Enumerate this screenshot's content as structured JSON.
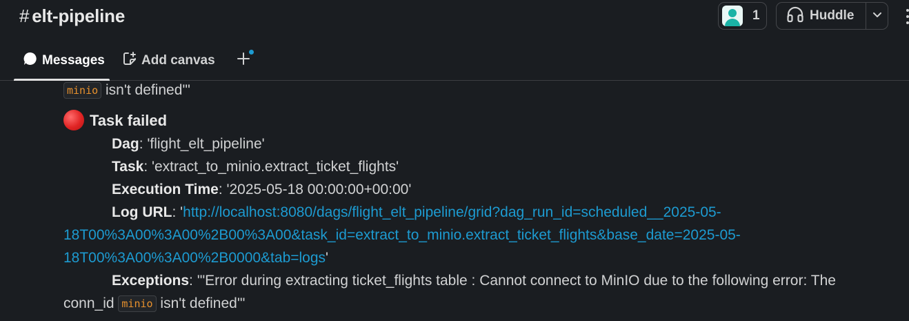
{
  "channel": {
    "hash": "#",
    "name": "elt-pipeline"
  },
  "header": {
    "members_count": "1",
    "huddle_label": "Huddle"
  },
  "tabs": [
    {
      "label": "Messages",
      "icon": "message-bubble-icon",
      "active": true
    },
    {
      "label": "Add canvas",
      "icon": "canvas-icon",
      "active": false
    }
  ],
  "message": {
    "prev_tail": {
      "code": "minio",
      "text": " isn't defined'\""
    },
    "title": "Task failed",
    "status_icon": "red-circle-icon",
    "fields": {
      "dag_label": "Dag",
      "dag_value": ": 'flight_elt_pipeline'",
      "task_label": "Task",
      "task_value": ": 'extract_to_minio.extract_ticket_flights'",
      "exec_label": "Execution Time",
      "exec_value": ": '2025-05-18 00:00:00+00:00'",
      "log_label": "Log URL",
      "log_prefix": ": '",
      "log_url_line1": "http://localhost:8080/dags/flight_elt_pipeline/grid?dag_run_id=scheduled__2025-05-",
      "log_url_line2": "18T00%3A00%3A00%2B00%3A00&task_id=extract_to_minio.extract_ticket_flights&base_date=2025-05-",
      "log_url_line3": "18T00%3A00%3A00%2B0000&tab=logs",
      "log_suffix": "'",
      "exceptions_label": "Exceptions",
      "exceptions_line1": ": '\"Error during extracting ticket_flights table : Cannot connect to MinIO due to the following error: The",
      "exceptions_line2_prefix": "conn_id ",
      "exceptions_code": "minio",
      "exceptions_line2_suffix": " isn't defined'\""
    }
  },
  "colors": {
    "background": "#1a1d21",
    "text": "#d1d2d3",
    "link": "#1d9bd1",
    "code_text": "#e8912d",
    "error_red": "#e02424"
  }
}
